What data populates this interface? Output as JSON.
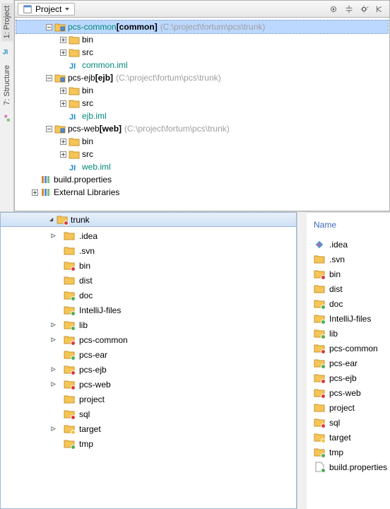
{
  "sidebar": {
    "tab_project": "1: Project",
    "tab_structure": "7: Structure"
  },
  "projectPane": {
    "comboLabel": "Project",
    "tree": [
      {
        "indent": 0,
        "toggle": "minus",
        "icon": "module",
        "label": "pcs-common",
        "bold": "[common]",
        "path": "(C:\\project\\fortum\\pcs\\trunk)",
        "selected": true,
        "color": "teal",
        "interact": true,
        "name": "module-pcs-common"
      },
      {
        "indent": 1,
        "toggle": "plus",
        "icon": "folder",
        "label": "bin",
        "interact": true,
        "name": "folder-bin"
      },
      {
        "indent": 1,
        "toggle": "plus",
        "icon": "folder",
        "label": "src",
        "interact": true,
        "name": "folder-src"
      },
      {
        "indent": 1,
        "toggle": "none",
        "icon": "iml",
        "label": "common.iml",
        "color": "teal",
        "interact": true,
        "name": "file-common-iml"
      },
      {
        "indent": 0,
        "toggle": "minus",
        "icon": "module",
        "label": "pcs-ejb",
        "bold": "[ejb]",
        "path": "(C:\\project\\fortum\\pcs\\trunk)",
        "interact": true,
        "name": "module-pcs-ejb"
      },
      {
        "indent": 1,
        "toggle": "plus",
        "icon": "folder",
        "label": "bin",
        "interact": true,
        "name": "folder-bin-2"
      },
      {
        "indent": 1,
        "toggle": "plus",
        "icon": "folder",
        "label": "src",
        "interact": true,
        "name": "folder-src-2"
      },
      {
        "indent": 1,
        "toggle": "none",
        "icon": "iml",
        "label": "ejb.iml",
        "color": "teal",
        "interact": true,
        "name": "file-ejb-iml"
      },
      {
        "indent": 0,
        "toggle": "minus",
        "icon": "module",
        "label": "pcs-web",
        "bold": "[web]",
        "path": "(C:\\project\\fortum\\pcs\\trunk)",
        "interact": true,
        "name": "module-pcs-web"
      },
      {
        "indent": 1,
        "toggle": "plus",
        "icon": "folder",
        "label": "bin",
        "interact": true,
        "name": "folder-bin-3"
      },
      {
        "indent": 1,
        "toggle": "plus",
        "icon": "folder",
        "label": "src",
        "interact": true,
        "name": "folder-src-3"
      },
      {
        "indent": 1,
        "toggle": "none",
        "icon": "iml",
        "label": "web.iml",
        "color": "teal",
        "interact": true,
        "name": "file-web-iml"
      },
      {
        "indent": -1,
        "toggle": "none",
        "icon": "lib",
        "label": "build.properties",
        "interact": true,
        "name": "file-build-properties"
      },
      {
        "indent": -1,
        "toggle": "plus",
        "icon": "lib",
        "label": "External Libraries",
        "interact": true,
        "name": "external-libraries"
      }
    ]
  },
  "fsLeft": {
    "root": "trunk",
    "items": [
      {
        "expand": true,
        "icon": "folder",
        "badge": "",
        "label": ".idea",
        "name": "fs-idea"
      },
      {
        "expand": false,
        "icon": "folder",
        "badge": "",
        "label": ".svn",
        "name": "fs-svn"
      },
      {
        "expand": false,
        "icon": "folder",
        "badge": "red",
        "label": "bin",
        "name": "fs-bin"
      },
      {
        "expand": false,
        "icon": "folder",
        "badge": "",
        "label": "dist",
        "name": "fs-dist"
      },
      {
        "expand": false,
        "icon": "folder",
        "badge": "green",
        "label": "doc",
        "name": "fs-doc"
      },
      {
        "expand": false,
        "icon": "folder",
        "badge": "green",
        "label": "IntelliJ-files",
        "name": "fs-intellij"
      },
      {
        "expand": true,
        "icon": "folder",
        "badge": "green",
        "label": "lib",
        "name": "fs-lib"
      },
      {
        "expand": true,
        "icon": "folder",
        "badge": "red",
        "label": "pcs-common",
        "name": "fs-pcs-common"
      },
      {
        "expand": false,
        "icon": "folder",
        "badge": "green",
        "label": "pcs-ear",
        "name": "fs-pcs-ear"
      },
      {
        "expand": true,
        "icon": "folder",
        "badge": "red",
        "label": "pcs-ejb",
        "name": "fs-pcs-ejb"
      },
      {
        "expand": true,
        "icon": "folder",
        "badge": "red",
        "label": "pcs-web",
        "name": "fs-pcs-web"
      },
      {
        "expand": false,
        "icon": "folder",
        "badge": "",
        "label": "project",
        "name": "fs-project"
      },
      {
        "expand": false,
        "icon": "folder",
        "badge": "red",
        "label": "sql",
        "name": "fs-sql"
      },
      {
        "expand": true,
        "icon": "folder",
        "badge": "yellow",
        "label": "target",
        "name": "fs-target"
      },
      {
        "expand": false,
        "icon": "folder",
        "badge": "green",
        "label": "tmp",
        "name": "fs-tmp"
      }
    ]
  },
  "fsRight": {
    "header": "Name",
    "items": [
      {
        "icon": "idea",
        "badge": "",
        "label": ".idea",
        "name": "fr-idea"
      },
      {
        "icon": "folder",
        "badge": "",
        "label": ".svn",
        "name": "fr-svn"
      },
      {
        "icon": "folder",
        "badge": "red",
        "label": "bin",
        "name": "fr-bin"
      },
      {
        "icon": "folder",
        "badge": "",
        "label": "dist",
        "name": "fr-dist"
      },
      {
        "icon": "folder",
        "badge": "green",
        "label": "doc",
        "name": "fr-doc"
      },
      {
        "icon": "folder",
        "badge": "green",
        "label": "IntelliJ-files",
        "name": "fr-intellij"
      },
      {
        "icon": "folder",
        "badge": "green",
        "label": "lib",
        "name": "fr-lib"
      },
      {
        "icon": "folder",
        "badge": "red",
        "label": "pcs-common",
        "name": "fr-pcs-common"
      },
      {
        "icon": "folder",
        "badge": "green",
        "label": "pcs-ear",
        "name": "fr-pcs-ear"
      },
      {
        "icon": "folder",
        "badge": "red",
        "label": "pcs-ejb",
        "name": "fr-pcs-ejb"
      },
      {
        "icon": "folder",
        "badge": "red",
        "label": "pcs-web",
        "name": "fr-pcs-web"
      },
      {
        "icon": "folder",
        "badge": "",
        "label": "project",
        "name": "fr-project"
      },
      {
        "icon": "folder",
        "badge": "red",
        "label": "sql",
        "name": "fr-sql"
      },
      {
        "icon": "folder",
        "badge": "yellow",
        "label": "target",
        "name": "fr-target"
      },
      {
        "icon": "folder",
        "badge": "green",
        "label": "tmp",
        "name": "fr-tmp"
      },
      {
        "icon": "file",
        "badge": "green",
        "label": "build.properties",
        "name": "fr-build-properties"
      }
    ]
  }
}
